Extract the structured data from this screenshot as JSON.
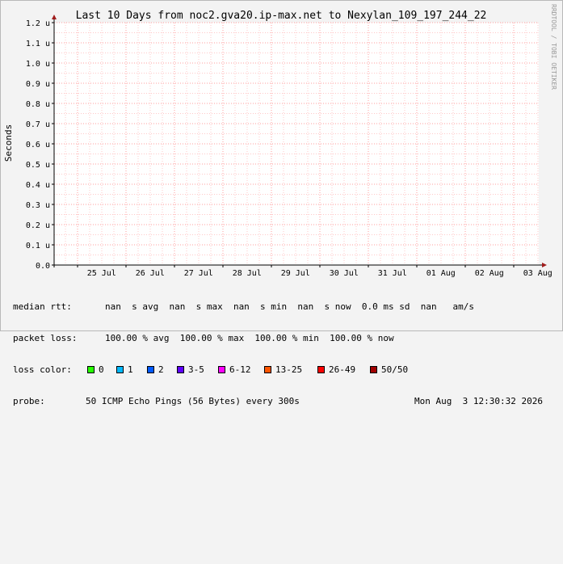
{
  "credit": "RRDTOOL / TOBI OETIKER",
  "colors": {
    "plot_bg": "#ffffff",
    "grid_minor": "#ffc8c8",
    "grid_major": "#ff9d9d",
    "axis": "#000000",
    "arrow": "#a01c1c"
  },
  "chart_data": {
    "type": "line",
    "title": "Last 10 Days from noc2.gva20.ip-max.net to Nexylan_109_197_244_22",
    "ylabel": "Seconds",
    "xlabel": "",
    "ylim": [
      0,
      1.2
    ],
    "y_ticks": [
      {
        "value": 0.0,
        "label": "0.0"
      },
      {
        "value": 0.1,
        "label": "0.1 u"
      },
      {
        "value": 0.2,
        "label": "0.2 u"
      },
      {
        "value": 0.3,
        "label": "0.3 u"
      },
      {
        "value": 0.4,
        "label": "0.4 u"
      },
      {
        "value": 0.5,
        "label": "0.5 u"
      },
      {
        "value": 0.6,
        "label": "0.6 u"
      },
      {
        "value": 0.7,
        "label": "0.7 u"
      },
      {
        "value": 0.8,
        "label": "0.8 u"
      },
      {
        "value": 0.9,
        "label": "0.9 u"
      },
      {
        "value": 1.0,
        "label": "1.0 u"
      },
      {
        "value": 1.1,
        "label": "1.1 u"
      },
      {
        "value": 1.2,
        "label": "1.2 u"
      }
    ],
    "x_range": [
      "2026-07-24T12:30",
      "2026-08-03T12:30"
    ],
    "x_ticks": [
      {
        "date": "2026-07-25",
        "label": "25 Jul"
      },
      {
        "date": "2026-07-26",
        "label": "26 Jul"
      },
      {
        "date": "2026-07-27",
        "label": "27 Jul"
      },
      {
        "date": "2026-07-28",
        "label": "28 Jul"
      },
      {
        "date": "2026-07-29",
        "label": "29 Jul"
      },
      {
        "date": "2026-07-30",
        "label": "30 Jul"
      },
      {
        "date": "2026-07-31",
        "label": "31 Jul"
      },
      {
        "date": "2026-08-01",
        "label": "01 Aug"
      },
      {
        "date": "2026-08-02",
        "label": "02 Aug"
      },
      {
        "date": "2026-08-03",
        "label": "03 Aug"
      }
    ],
    "grid": true,
    "series": []
  },
  "legend": {
    "median_rtt": {
      "label": "median rtt:",
      "values": "nan  s avg  nan  s max  nan  s min  nan  s now  0.0 ms sd  nan   am/s"
    },
    "packet_loss": {
      "label": "packet loss:",
      "values": "100.00 % avg  100.00 % max  100.00 % min  100.00 % now"
    },
    "loss_color": {
      "label": "loss color:",
      "items": [
        {
          "label": "0",
          "color": "#26ff00"
        },
        {
          "label": "1",
          "color": "#00b8ff"
        },
        {
          "label": "2",
          "color": "#0059ff"
        },
        {
          "label": "3-5",
          "color": "#5e00ff"
        },
        {
          "label": "6-12",
          "color": "#ff00ff"
        },
        {
          "label": "13-25",
          "color": "#ff5500"
        },
        {
          "label": "26-49",
          "color": "#ff0000"
        },
        {
          "label": "50/50",
          "color": "#a10000"
        }
      ]
    },
    "probe": {
      "label": "probe:",
      "text": "50 ICMP Echo Pings (56 Bytes) every 300s",
      "timestamp": "Mon Aug  3 12:30:32 2026"
    }
  }
}
